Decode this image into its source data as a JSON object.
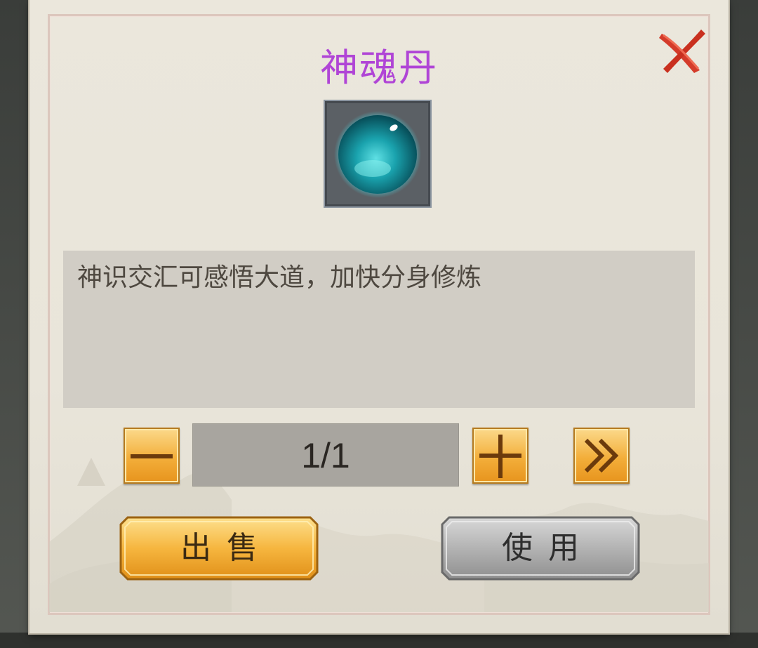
{
  "dialog": {
    "title": "神魂丹",
    "title_color": "#b045d6",
    "item_icon": "teal-orb-icon",
    "description": "神识交汇可感悟大道，加快分身修炼",
    "close_icon": "close-x-icon"
  },
  "quantity": {
    "value_text": "1/1",
    "current": 1,
    "max": 1,
    "minus_icon": "minus-icon",
    "plus_icon": "plus-icon",
    "max_icon": "double-chevron-right-icon"
  },
  "actions": {
    "sell_label": "出售",
    "use_label": "使用",
    "sell_color": "#f3ae3a",
    "use_color": "#a9a9a9"
  }
}
